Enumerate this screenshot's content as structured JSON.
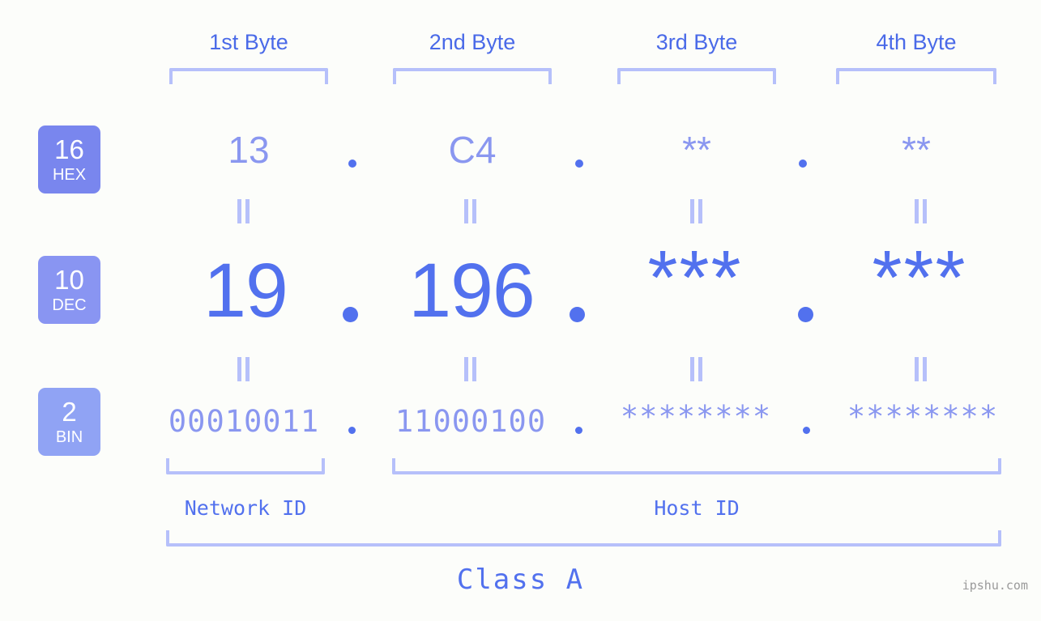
{
  "meta": {
    "background_color": "#fcfdfa",
    "accent_color": "#5271ee",
    "light_accent_color": "#8a97f0",
    "bracket_color": "#b6c0fa",
    "watermark": "ipshu.com"
  },
  "byte_headers": [
    {
      "label": "1st Byte"
    },
    {
      "label": "2nd Byte"
    },
    {
      "label": "3rd Byte"
    },
    {
      "label": "4th Byte"
    }
  ],
  "rows": {
    "hex": {
      "badge_number": "16",
      "badge_name": "HEX",
      "values": [
        "13",
        "C4",
        "**",
        "**"
      ],
      "separator": "."
    },
    "dec": {
      "badge_number": "10",
      "badge_name": "DEC",
      "values": [
        "19",
        "196",
        "***",
        "***"
      ],
      "separator": "."
    },
    "bin": {
      "badge_number": "2",
      "badge_name": "BIN",
      "values": [
        "00010011",
        "11000100",
        "********",
        "********"
      ],
      "separator": "."
    }
  },
  "equals_marks": {
    "symbol": "||",
    "count_per_gap": 4
  },
  "id_groups": [
    {
      "label": "Network ID"
    },
    {
      "label": "Host ID"
    }
  ],
  "class_label": "Class A"
}
